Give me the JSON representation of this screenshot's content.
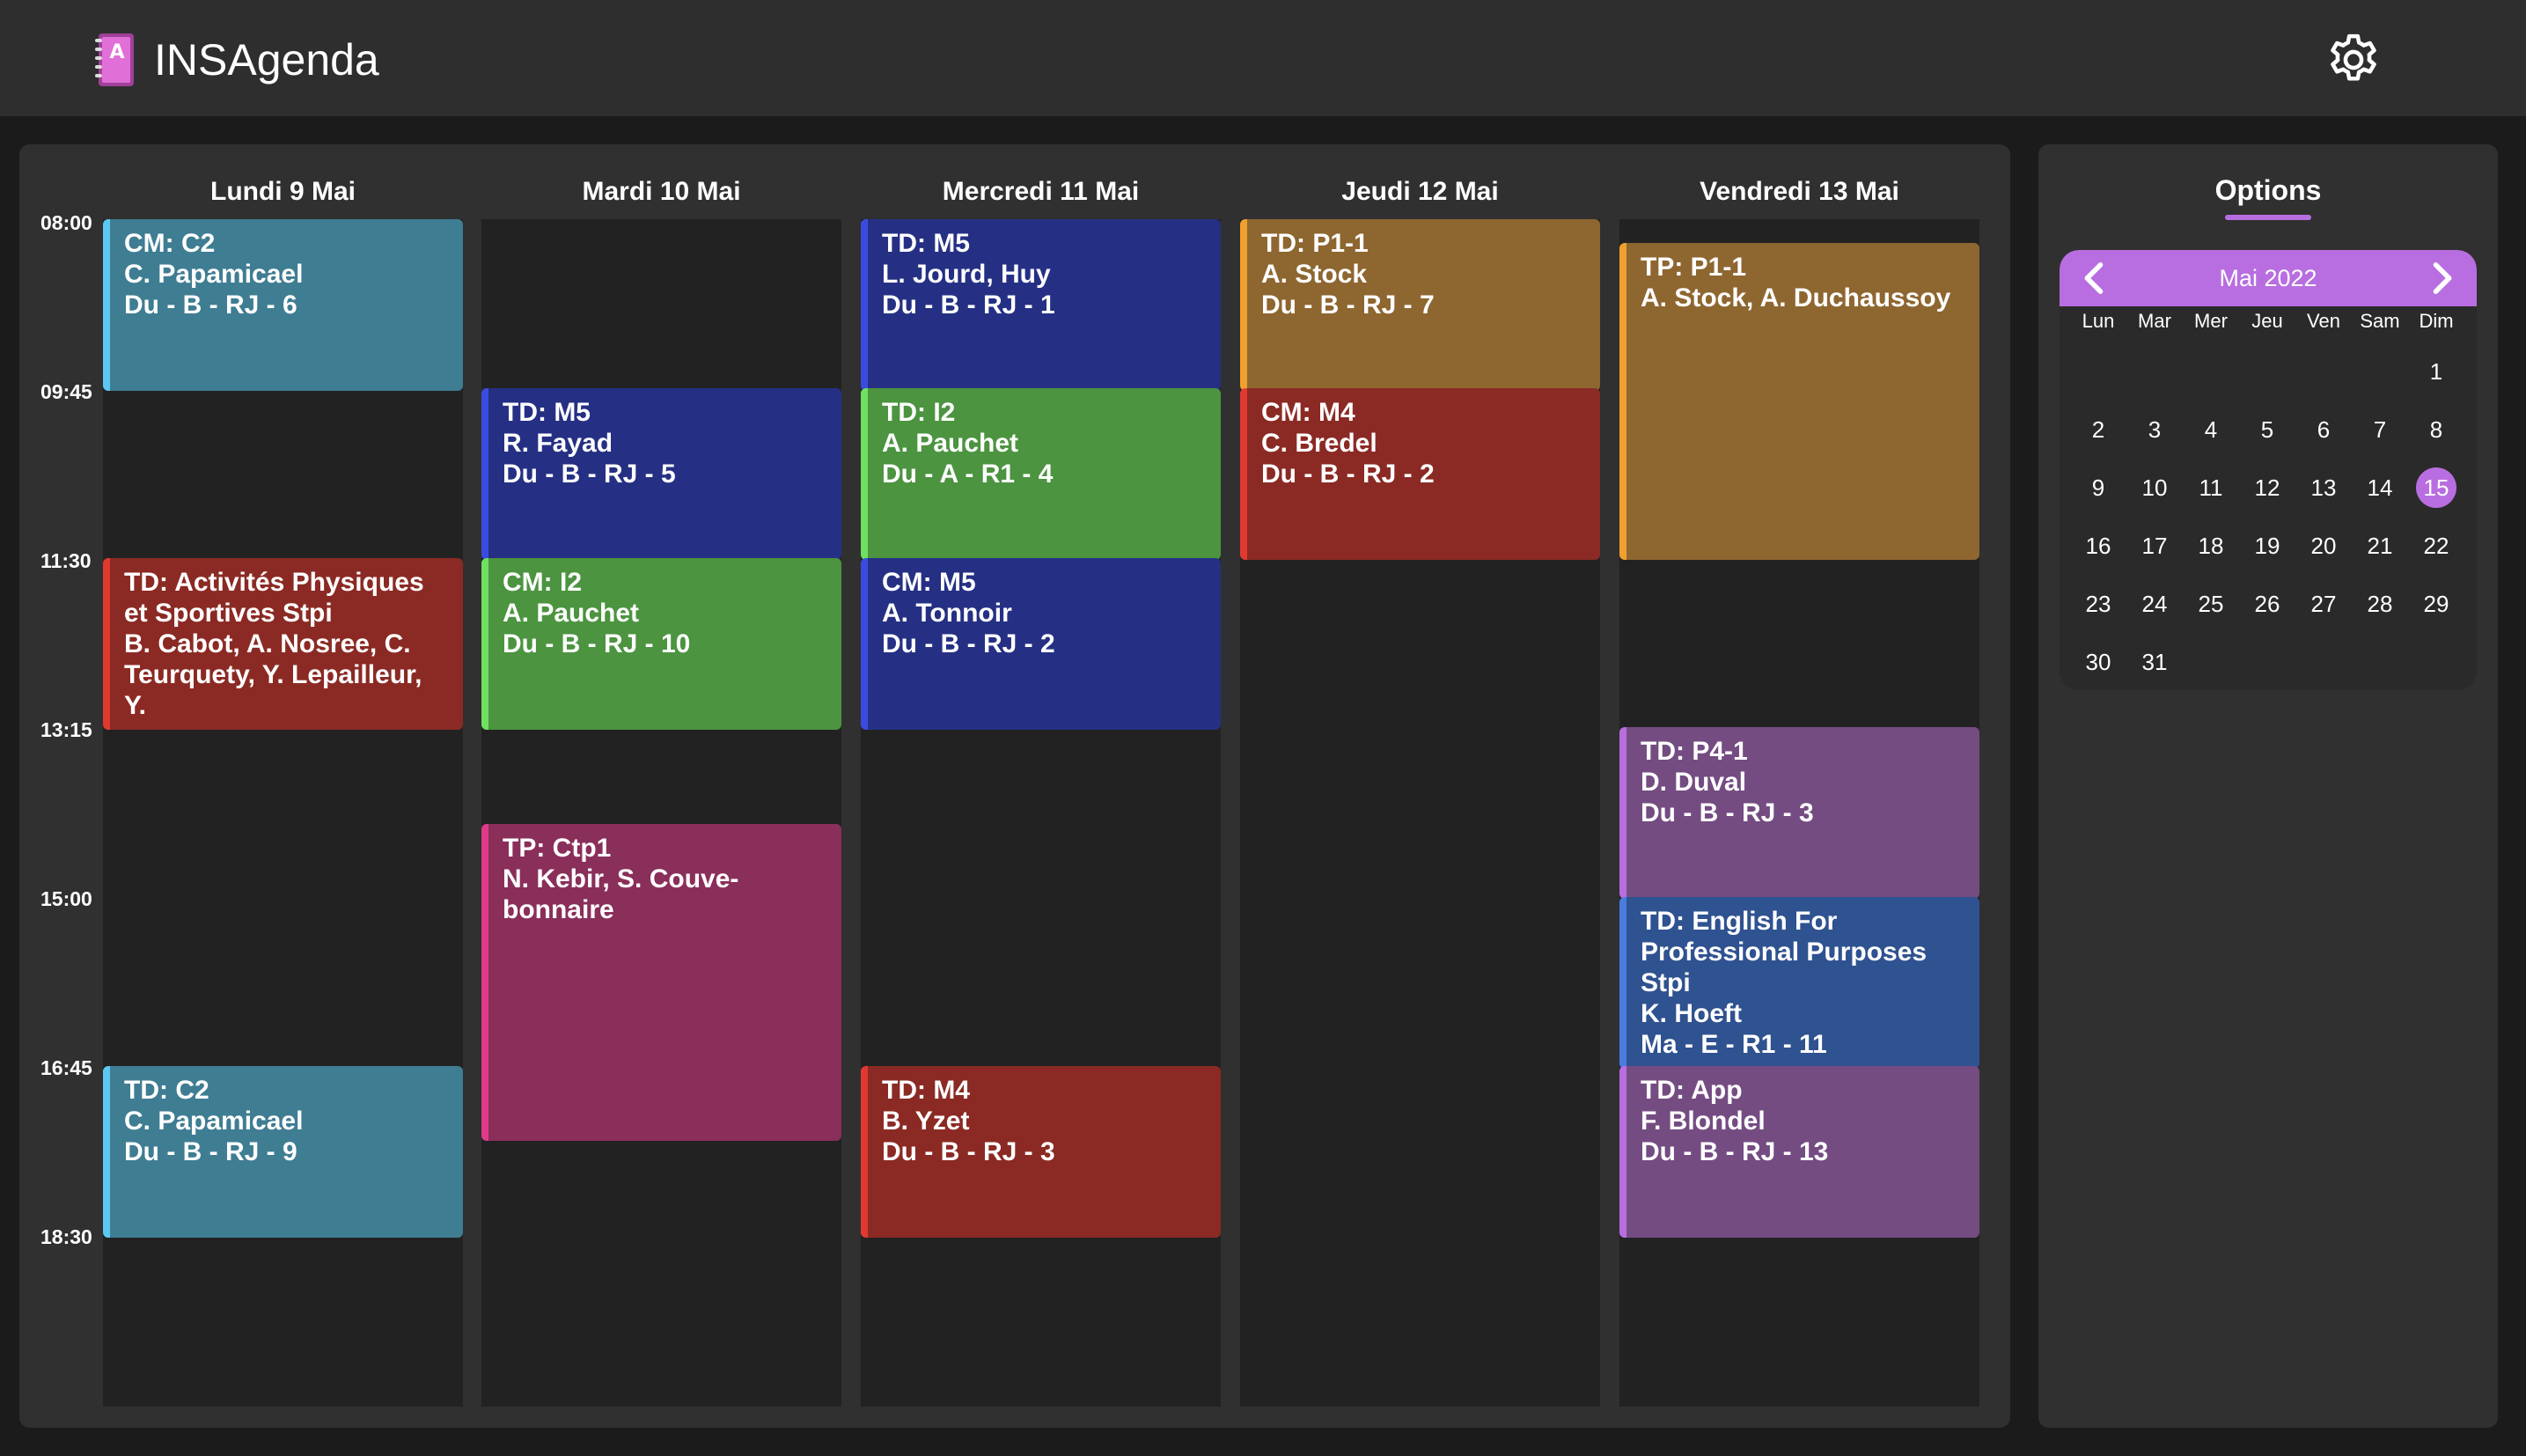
{
  "app": {
    "title": "INSAgenda"
  },
  "colors": {
    "accent": "#b86ee0",
    "teal": "#3f7d93",
    "navy": "#253084",
    "green": "#4c9440",
    "red": "#8b2a24",
    "ochre": "#8e6630",
    "magenta": "#8a2e5a",
    "purple": "#744c82",
    "blue": "#2f5290"
  },
  "timeline": {
    "times": [
      "08:00",
      "09:45",
      "11:30",
      "13:15",
      "15:00",
      "16:45",
      "18:30"
    ]
  },
  "days": [
    {
      "label": "Lundi 9 Mai",
      "events": [
        {
          "lines": [
            "CM: C2",
            "C. Papamicael",
            "Du - B - RJ - 6"
          ],
          "start": "08:00",
          "end": "09:30",
          "color": "#3f7d93",
          "stripe": "#5cc8f2"
        },
        {
          "lines": [
            "TD: Activités Physiques et Sportives Stpi",
            "B. Cabot, A. Nosree, C. Teurquety, Y. Lepailleur, Y."
          ],
          "start": "11:30",
          "end": "13:00",
          "color": "#8b2a24",
          "stripe": "#e03a30"
        },
        {
          "lines": [
            "TD: C2",
            "C. Papamicael",
            "Du - B - RJ - 9"
          ],
          "start": "16:45",
          "end": "18:15",
          "color": "#3f7d93",
          "stripe": "#5cc8f2"
        }
      ]
    },
    {
      "label": "Mardi 10 Mai",
      "events": [
        {
          "lines": [
            "TD: M5",
            "R. Fayad",
            "Du - B - RJ - 5"
          ],
          "start": "09:45",
          "end": "11:15",
          "color": "#253084",
          "stripe": "#3a4ce0"
        },
        {
          "lines": [
            "CM: I2",
            "A. Pauchet",
            "Du - B - RJ - 10"
          ],
          "start": "11:30",
          "end": "13:00",
          "color": "#4c9440",
          "stripe": "#6fe060"
        },
        {
          "lines": [
            "TP: Ctp1",
            "N. Kebir, S. Couve-bonnaire"
          ],
          "start": "14:15",
          "end": "17:15",
          "color": "#8a2e5a",
          "stripe": "#e03a8a"
        }
      ]
    },
    {
      "label": "Mercredi 11 Mai",
      "events": [
        {
          "lines": [
            "TD: M5",
            "L. Jourd, Huy",
            "Du - B - RJ - 1"
          ],
          "start": "08:00",
          "end": "09:30",
          "color": "#253084",
          "stripe": "#3a4ce0"
        },
        {
          "lines": [
            "TD: I2",
            "A. Pauchet",
            "Du - A - R1 - 4"
          ],
          "start": "09:45",
          "end": "11:15",
          "color": "#4c9440",
          "stripe": "#6fe060"
        },
        {
          "lines": [
            "CM: M5",
            "A. Tonnoir",
            "Du - B - RJ - 2"
          ],
          "start": "11:30",
          "end": "13:00",
          "color": "#253084",
          "stripe": "#3a4ce0"
        },
        {
          "lines": [
            "TD: M4",
            "B. Yzet",
            "Du - B - RJ - 3"
          ],
          "start": "16:45",
          "end": "18:15",
          "color": "#8b2a24",
          "stripe": "#e03a30"
        }
      ]
    },
    {
      "label": "Jeudi 12 Mai",
      "events": [
        {
          "lines": [
            "TD: P1-1",
            "A. Stock",
            "Du - B - RJ - 7"
          ],
          "start": "08:00",
          "end": "09:30",
          "color": "#8e6630",
          "stripe": "#f0a030"
        },
        {
          "lines": [
            "CM: M4",
            "C. Bredel",
            "Du - B - RJ - 2"
          ],
          "start": "09:45",
          "end": "11:15",
          "color": "#8b2a24",
          "stripe": "#e03a30"
        }
      ]
    },
    {
      "label": "Vendredi 13 Mai",
      "events": [
        {
          "lines": [
            "TP: P1-1",
            "A. Stock, A. Duchaussoy"
          ],
          "start": "08:15",
          "end": "11:15",
          "color": "#8e6630",
          "stripe": "#f0a030"
        },
        {
          "lines": [
            "TD: P4-1",
            "D. Duval",
            "Du - B - RJ - 3"
          ],
          "start": "13:15",
          "end": "14:45",
          "color": "#744c82",
          "stripe": "#b86ee0"
        },
        {
          "lines": [
            "TD: English For Professional Purposes Stpi",
            "K. Hoeft",
            "Ma - E - R1 - 11"
          ],
          "start": "15:00",
          "end": "16:30",
          "color": "#2f5290",
          "stripe": "#4a7ce0"
        },
        {
          "lines": [
            "TD: App",
            "F. Blondel",
            "Du - B - RJ - 13"
          ],
          "start": "16:45",
          "end": "18:15",
          "color": "#744c82",
          "stripe": "#b86ee0"
        }
      ]
    }
  ],
  "options": {
    "tab_label": "Options",
    "calendar": {
      "month_label": "Mai 2022",
      "weekdays": [
        "Lun",
        "Mar",
        "Mer",
        "Jeu",
        "Ven",
        "Sam",
        "Dim"
      ],
      "first_weekday_index": 6,
      "days_in_month": 31,
      "selected_day": 15
    }
  },
  "icons": {
    "logo": "agenda-notebook-icon",
    "settings": "gear-icon",
    "prev": "chevron-left-icon",
    "next": "chevron-right-icon"
  }
}
